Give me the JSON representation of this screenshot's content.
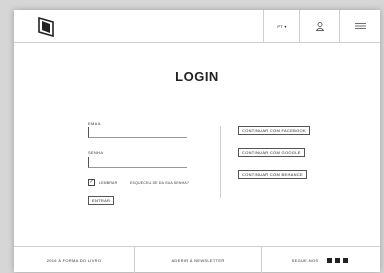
{
  "header": {
    "language": "PT ▾",
    "icons": [
      "logo-mark",
      "user-icon",
      "hamburger-menu-icon"
    ]
  },
  "login": {
    "title": "LOGIN",
    "email_label": "EMAIL",
    "email_value": "",
    "password_label": "SENHA",
    "password_value": "",
    "remember_label": "LEMBRAR",
    "remember_checked": true,
    "forgot_link": "ESQUECEU-SE DA SUA SENHA?",
    "submit_label": "ENTRAR"
  },
  "social": {
    "facebook": "CONTINUAR COM FACEBOOK",
    "google": "CONTINUAR COM GOOGLE",
    "behance": "CONTINUAR COM BEHANCE"
  },
  "footer": {
    "copyright": "2016 À FORMA DO LIVRO",
    "newsletter": "ADERIR À NEWSLETTER",
    "follow": "SEGUE-NOS",
    "social_icons": [
      "facebook-icon",
      "instagram-icon",
      "behance-icon"
    ]
  }
}
